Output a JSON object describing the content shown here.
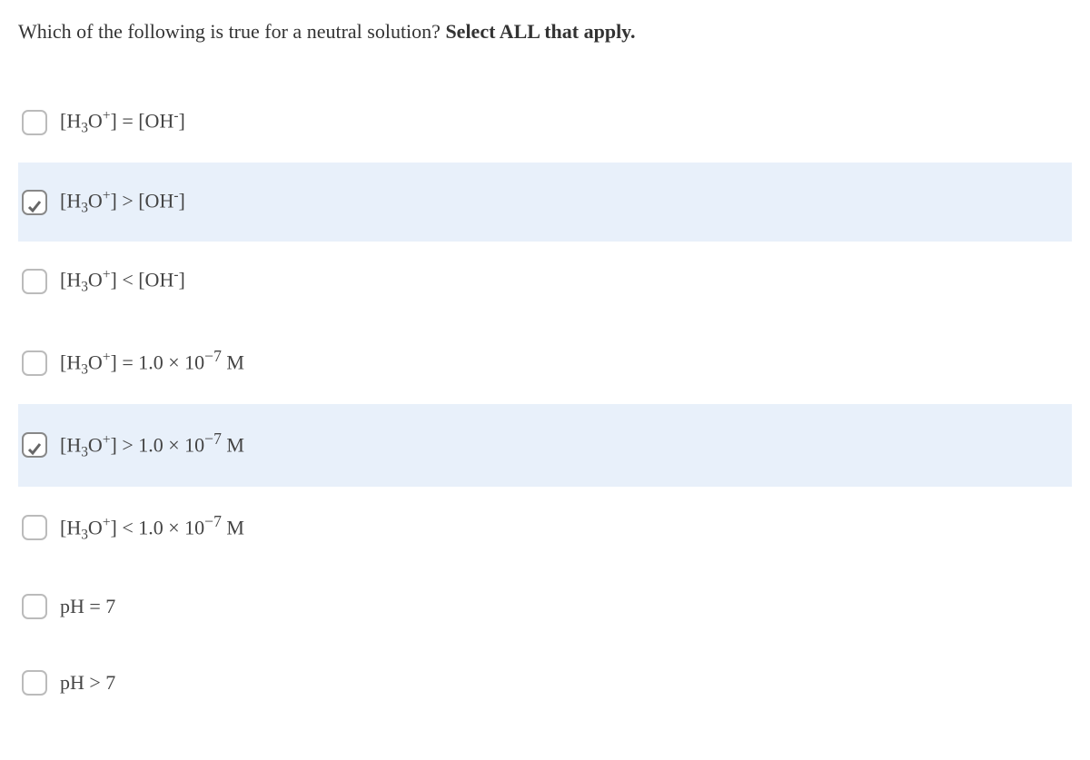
{
  "question": {
    "prefix": "Which of the following is true for a neutral solution?  ",
    "bold": "Select ALL that apply."
  },
  "options": [
    {
      "html": "[H<sub>3</sub>O<sup>+</sup>] = [OH<sup>-</sup>]",
      "checked": false
    },
    {
      "html": "[H<sub>3</sub>O<sup>+</sup>] > [OH<sup>-</sup>]",
      "checked": true
    },
    {
      "html": "[H<sub>3</sub>O<sup>+</sup>] < [OH<sup>-</sup>]",
      "checked": false
    },
    {
      "html": "[H<sub>3</sub>O<sup>+</sup>] = 1.0 × 10<span class='sup-big'>−7</span> M",
      "checked": false
    },
    {
      "html": "[H<sub>3</sub>O<sup>+</sup>] > 1.0 × 10<span class='sup-big'>−7</span> M",
      "checked": true
    },
    {
      "html": "[H<sub>3</sub>O<sup>+</sup>] < 1.0 × 10<span class='sup-big'>−7</span> M",
      "checked": false
    },
    {
      "html": "pH = 7",
      "checked": false
    },
    {
      "html": "pH > 7",
      "checked": false
    }
  ]
}
